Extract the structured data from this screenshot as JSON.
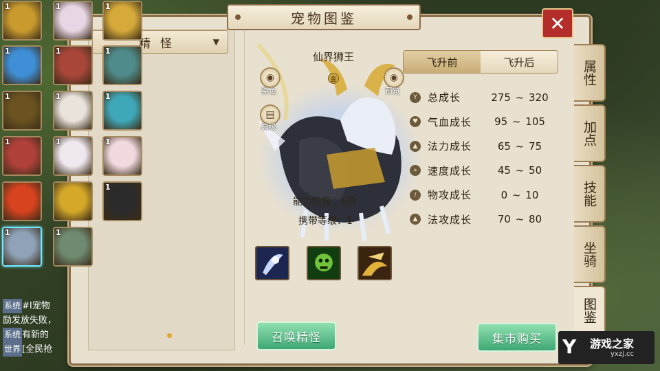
{
  "title": "宠物图鉴",
  "close_label": "✕",
  "filter": {
    "selected": "精怪",
    "arrow": "▼"
  },
  "pets": [
    {
      "num": "1",
      "color": "#c99a2e"
    },
    {
      "num": "1",
      "color": "#e8d6e4"
    },
    {
      "num": "1",
      "color": "#d5a93a"
    },
    {
      "num": "1",
      "color": "#3f8fd6"
    },
    {
      "num": "1",
      "color": "#a8463a"
    },
    {
      "num": "1",
      "color": "#4e8b8a"
    },
    {
      "num": "1",
      "color": "#6a5320"
    },
    {
      "num": "1",
      "color": "#e9e3dc"
    },
    {
      "num": "1",
      "color": "#3fa8b8"
    },
    {
      "num": "1",
      "color": "#b0403a"
    },
    {
      "num": "1",
      "color": "#efe8ee"
    },
    {
      "num": "1",
      "color": "#f1d9de"
    },
    {
      "num": "",
      "color": "#d8431f"
    },
    {
      "num": "",
      "color": "#d5a82a"
    },
    {
      "num": "1",
      "color": "#2b2b2b"
    },
    {
      "num": "1",
      "color": "#8fa2b8"
    },
    {
      "num": "1",
      "color": "#6f8a70"
    }
  ],
  "pet": {
    "name": "仙界狮王",
    "grade_badge": "金",
    "dye_label": "染色",
    "preview_label": "预览",
    "bio_label": "高级",
    "ability_label": "能力阶段：",
    "ability_value": "6阶",
    "carry_label": "携带等级：",
    "carry_value": "1"
  },
  "tabs": [
    "飞升前",
    "飞升后"
  ],
  "stats": [
    {
      "label": "总成长",
      "value": "275 ~ 320",
      "icon": "Y"
    },
    {
      "label": "气血成长",
      "value": "95 ~ 105",
      "icon": "♥"
    },
    {
      "label": "法力成长",
      "value": "65 ~ 75",
      "icon": "▲"
    },
    {
      "label": "速度成长",
      "value": "45 ~ 50",
      "icon": "»"
    },
    {
      "label": "物攻成长",
      "value": "0 ~ 10",
      "icon": "/"
    },
    {
      "label": "法攻成长",
      "value": "70 ~ 80",
      "icon": "▲"
    }
  ],
  "buttons": {
    "summon": "召唤精怪",
    "market": "集市购买"
  },
  "side_tabs": [
    "属性",
    "加点",
    "技能",
    "坐骑",
    "图鉴"
  ],
  "chat": [
    {
      "tag": "系统",
      "text": "#I宠物"
    },
    {
      "tag": "",
      "text": "励发放失败，"
    },
    {
      "tag": "系统",
      "text": "有新的"
    },
    {
      "tag": "世界",
      "text": "[全民抢"
    }
  ],
  "watermark": {
    "name": "游戏之家",
    "url": "yxzj.cc"
  }
}
